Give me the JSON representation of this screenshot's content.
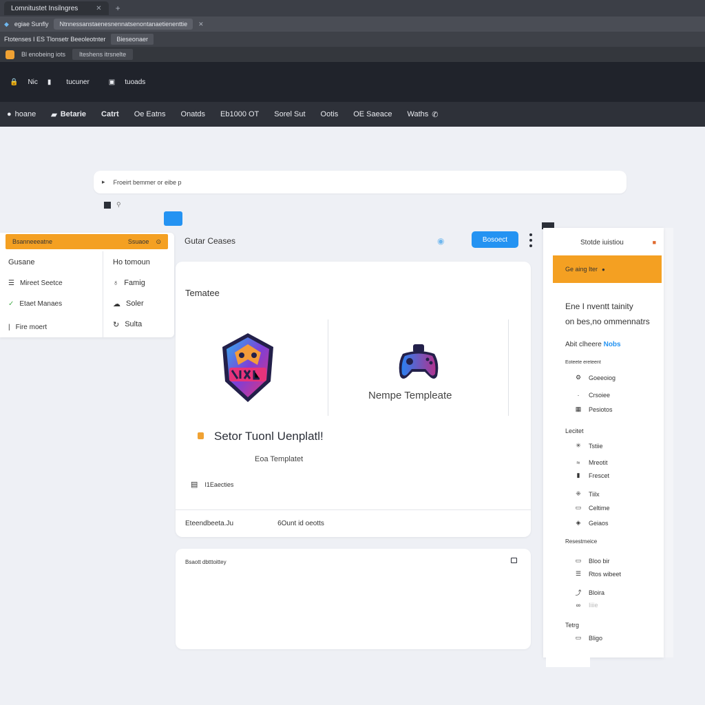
{
  "browser": {
    "tabs": [
      {
        "label": "Lomnitustet Insilngres"
      },
      {
        "label": "egiae Sunfly"
      },
      {
        "label": "Ntnnessanstaenesnennatsenontanaetienenttie"
      }
    ],
    "address_left": "Ftotenses I  ES Tlonsetr Beeoleotnter",
    "address_pill": "Bieseonaer",
    "ext_label": "Bl enobeing iots",
    "ext_pill": "Iteshens itrsnelte"
  },
  "app_header": {
    "left_label": "Nic",
    "user_label": "tucuner",
    "user_sub": "tuoads"
  },
  "nav": {
    "items": [
      "hoane",
      "Betarie",
      "Catrt",
      "Oe Eatns",
      "Onatds",
      "Eb1000 OT",
      "Sorel Sut",
      "Ootis",
      "OE Saeace",
      "Waths"
    ]
  },
  "search": {
    "placeholder": "Froeirt bemmer or eibe p"
  },
  "left_menu": {
    "bar_label": "Bsanneeeatne",
    "bar_right": "Ssuaoe",
    "col1": [
      "Gusane",
      "Mireet Seetce",
      "Etaet Manaes",
      "Fire moert"
    ],
    "col2_title": "Ho tomoun",
    "col2": [
      "Famig",
      "Soler",
      "Sulta"
    ]
  },
  "toolbar": {
    "section_title": "Gutar Ceases",
    "primary_button": "Bosoect"
  },
  "main_card": {
    "title": "Tematee",
    "logo_label": "Nempe Templeate",
    "hero_title": "Setor Tuonl Uenplatl!",
    "hero_sub": "Eoa Templatet",
    "meta_label": "I1Eaecties",
    "footer_left": "Eteendbeeta.Ju",
    "footer_right": "6Ount id oeotts"
  },
  "second_card": {
    "label": "Bsaott dbtttoittey"
  },
  "right_panel": {
    "title": "Stotde iuistiou",
    "orange_label": "Ge aing Iter",
    "desc_line1": "Ene I nventt tainity",
    "desc_line2": "on bes,no ommennatrs",
    "link_prefix": "Abit clheere",
    "link_accent": "Nobs",
    "group1": "Eoteete ereteent",
    "group1_items": [
      "Goeeoiog",
      "Crsoiee",
      "Pesiotos"
    ],
    "group2": "Lecitet",
    "group2_items": [
      "Tstiie",
      "Mreotit",
      "Frescet"
    ],
    "group3_items": [
      "Tiilx",
      "Celtime",
      "Geiaos"
    ],
    "group4": "Resestmeice",
    "group4_items": [
      "Bloo bir",
      "Rtos wibeet",
      "Bloira",
      "Iiiie"
    ],
    "group5": "Tetrg",
    "group5_items": [
      "Bligo"
    ]
  },
  "colors": {
    "accent_blue": "#2493f2",
    "accent_orange": "#f4a022",
    "header_dark": "#20232b"
  }
}
